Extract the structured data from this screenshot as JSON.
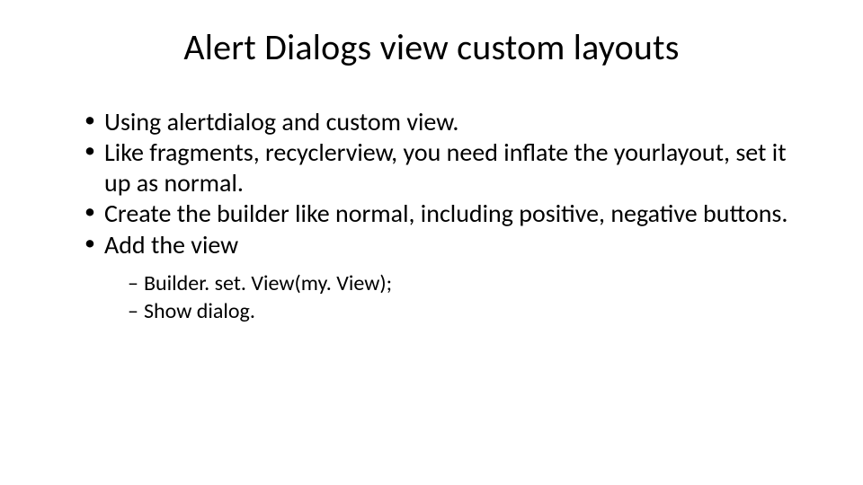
{
  "slide": {
    "title": "Alert Dialogs view custom layouts",
    "bullets": [
      {
        "text": "Using alertdialog and custom view."
      },
      {
        "text": "Like fragments, recyclerview, you need inflate the yourlayout, set it up as normal."
      },
      {
        "text": "Create the builder like normal, including positive, negative buttons."
      },
      {
        "text": "Add the view",
        "children": [
          {
            "text": "Builder. set. View(my. View);"
          },
          {
            "text": "Show dialog."
          }
        ]
      }
    ]
  }
}
